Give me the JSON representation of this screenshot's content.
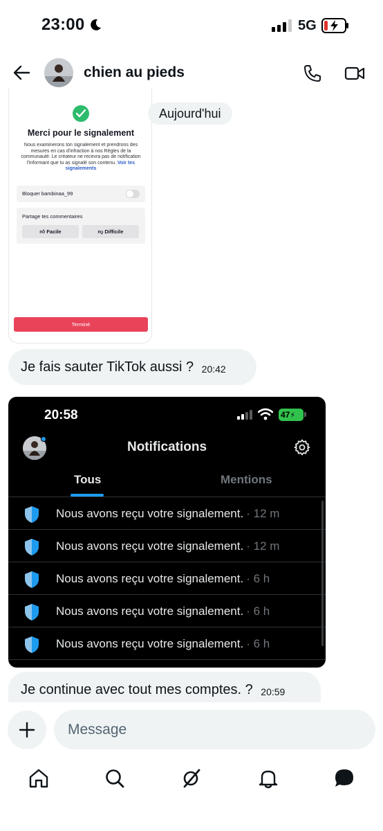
{
  "status_bar": {
    "time": "23:00",
    "network": "5G"
  },
  "header": {
    "contact_name": "chien au pieds"
  },
  "date_separator": "Aujourd'hui",
  "tiktok_screenshot": {
    "title": "Merci pour le signalement",
    "description": "Nous examinerons ton signalement et prendrons des mesures en cas d'infraction à nos Règles de la communauté. Le créateur ne recevra pas de notification l'informant que tu as signalé son contenu.",
    "link_text": "Voir tes signalements",
    "block_label": "Bloquer bambinaa_99",
    "share_label": "Partage tes commentaires",
    "easy_label": "Facile",
    "hard_label": "Difficile",
    "done_label": "Terminé"
  },
  "messages": [
    {
      "text": "Je fais sauter TikTok  aussi ?",
      "time": "20:42"
    },
    {
      "text": "Je continue avec tout mes comptes. ?",
      "time": "20:59"
    }
  ],
  "x_screenshot": {
    "time": "20:58",
    "battery": "47",
    "title": "Notifications",
    "tabs": [
      "Tous",
      "Mentions"
    ],
    "notifications": [
      {
        "text": "Nous avons reçu votre signalement.",
        "sep": "·",
        "time": "12 m"
      },
      {
        "text": "Nous avons reçu votre signalement.",
        "sep": "·",
        "time": "12 m"
      },
      {
        "text": "Nous avons reçu votre signalement.",
        "sep": "·",
        "time": "6 h"
      },
      {
        "text": "Nous avons reçu votre signalement.",
        "sep": "·",
        "time": "6 h"
      },
      {
        "text": "Nous avons reçu votre signalement.",
        "sep": "·",
        "time": "6 h"
      }
    ]
  },
  "compose": {
    "placeholder": "Message"
  },
  "nav": {
    "icons": [
      "home-icon",
      "search-icon",
      "grok-icon",
      "bell-icon",
      "messages-icon"
    ]
  },
  "colors": {
    "accent": "#1d9bf0",
    "bubble": "#eff3f4",
    "tiktok_red": "#e9435a",
    "success_green": "#2dbb6c"
  }
}
